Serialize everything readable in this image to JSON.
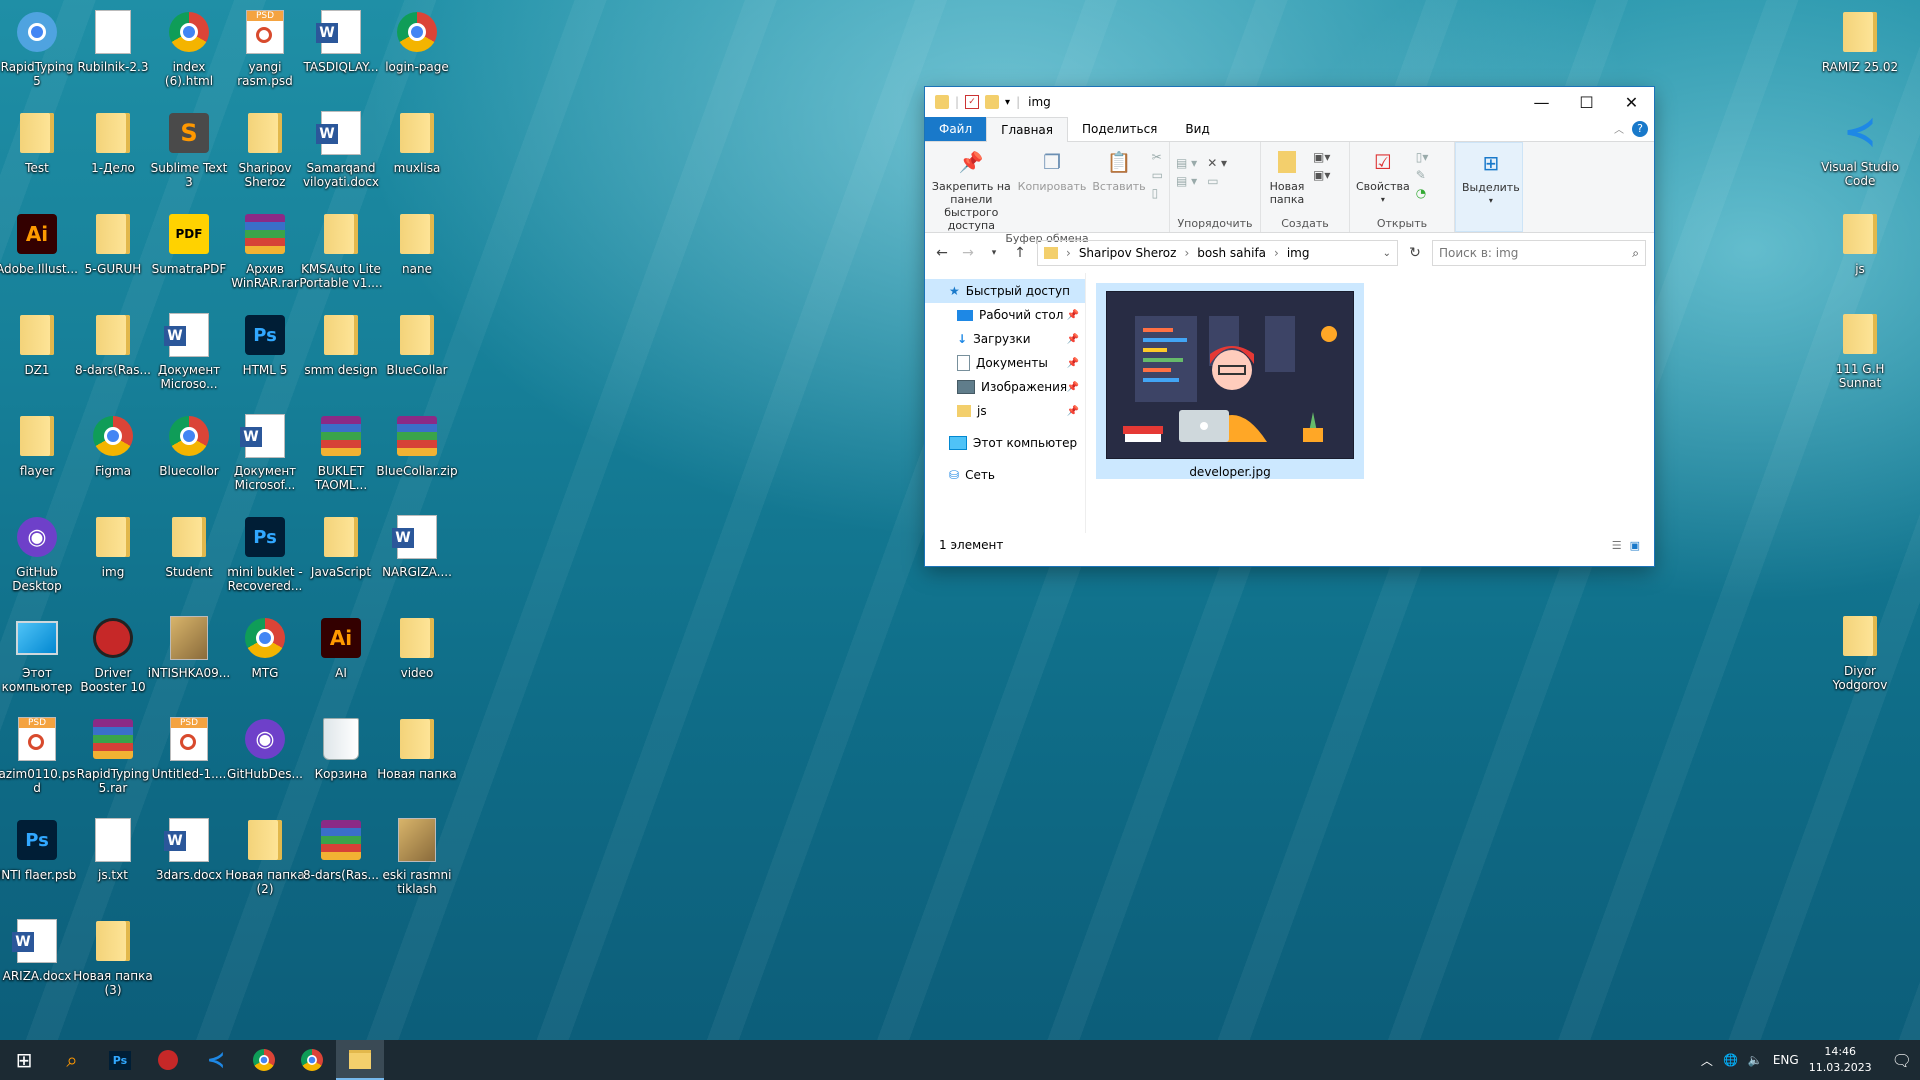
{
  "desktop": {
    "icons": [
      {
        "label": "RapidTyping 5",
        "icon": "rapidtyping-icon"
      },
      {
        "label": "Rubilnik-2.3",
        "icon": "document-icon"
      },
      {
        "label": "index (6).html",
        "icon": "chrome-icon"
      },
      {
        "label": "yangi rasm.psd",
        "icon": "psd-icon"
      },
      {
        "label": "TASDIQLAY...",
        "icon": "word-icon"
      },
      {
        "label": "login-page",
        "icon": "chrome-icon"
      },
      {
        "label": "Test",
        "icon": "folder-icon"
      },
      {
        "label": "1-Дело",
        "icon": "folder-icon"
      },
      {
        "label": "Sublime Text 3",
        "icon": "sublime-icon"
      },
      {
        "label": "Sharipov Sheroz",
        "icon": "folder-icon"
      },
      {
        "label": "Samarqand viloyati.docx",
        "icon": "word-icon"
      },
      {
        "label": "muxlisa",
        "icon": "folder-icon"
      },
      {
        "label": "Adobe.Illust...",
        "icon": "illustrator-icon"
      },
      {
        "label": "5-GURUH",
        "icon": "folder-icon"
      },
      {
        "label": "SumatraPDF",
        "icon": "pdf-icon"
      },
      {
        "label": "Архив WinRAR.rar",
        "icon": "winrar-icon"
      },
      {
        "label": "KMSAuto Lite Portable v1....",
        "icon": "folder-icon"
      },
      {
        "label": "nane",
        "icon": "folder-icon"
      },
      {
        "label": "DZ1",
        "icon": "folder-icon"
      },
      {
        "label": "8-dars(Ras...",
        "icon": "folder-icon"
      },
      {
        "label": "Документ Microso...",
        "icon": "word-icon"
      },
      {
        "label": "HTML 5",
        "icon": "photoshop-icon"
      },
      {
        "label": "smm design",
        "icon": "folder-icon"
      },
      {
        "label": "BlueCollar",
        "icon": "folder-icon"
      },
      {
        "label": "flayer",
        "icon": "folder-icon"
      },
      {
        "label": "Figma",
        "icon": "chrome-icon"
      },
      {
        "label": "Bluecollor",
        "icon": "chrome-icon"
      },
      {
        "label": "Документ Microsof...",
        "icon": "word-icon"
      },
      {
        "label": "BUKLET TAOML...",
        "icon": "winrar-icon"
      },
      {
        "label": "BlueCollar.zip",
        "icon": "winrar-icon"
      },
      {
        "label": "GitHub Desktop",
        "icon": "github-icon"
      },
      {
        "label": "img",
        "icon": "folder-icon"
      },
      {
        "label": "Student",
        "icon": "folder-icon"
      },
      {
        "label": "mini buklet -Recovered...",
        "icon": "photoshop-icon"
      },
      {
        "label": "JavaScript",
        "icon": "folder-icon"
      },
      {
        "label": "NARGIZA....",
        "icon": "word-icon"
      },
      {
        "label": "Этот компьютер",
        "icon": "computer-icon"
      },
      {
        "label": "Driver Booster 10",
        "icon": "driver-booster-icon"
      },
      {
        "label": "iNTISHKA09...",
        "icon": "image-file-icon"
      },
      {
        "label": "MTG",
        "icon": "chrome-icon"
      },
      {
        "label": "AI",
        "icon": "illustrator-icon"
      },
      {
        "label": "video",
        "icon": "folder-icon"
      },
      {
        "label": "azim0110.psd",
        "icon": "psd-icon"
      },
      {
        "label": "RapidTyping 5.rar",
        "icon": "winrar-icon"
      },
      {
        "label": "Untitled-1....",
        "icon": "psd-icon"
      },
      {
        "label": "GitHubDes...",
        "icon": "github-icon"
      },
      {
        "label": "Корзина",
        "icon": "recycle-bin-icon"
      },
      {
        "label": "Новая папка",
        "icon": "folder-icon"
      },
      {
        "label": "INTI flaer.psb",
        "icon": "photoshop-icon"
      },
      {
        "label": "js.txt",
        "icon": "text-file-icon"
      },
      {
        "label": "3dars.docx",
        "icon": "word-icon"
      },
      {
        "label": "Новая папка (2)",
        "icon": "folder-icon"
      },
      {
        "label": "8-dars(Ras...",
        "icon": "winrar-icon"
      },
      {
        "label": "eski rasmni tiklash",
        "icon": "image-file-icon"
      },
      {
        "label": "ARIZA.docx",
        "icon": "word-icon"
      },
      {
        "label": "Новая папка (3)",
        "icon": "folder-icon"
      }
    ],
    "right_icons": [
      {
        "label": "RAMIZ 25.02",
        "icon": "folder-icon"
      },
      {
        "label": "Visual Studio Code",
        "icon": "vscode-icon"
      },
      {
        "label": "js",
        "icon": "folder-icon"
      },
      {
        "label": "111 G.H Sunnat",
        "icon": "folder-icon"
      },
      {
        "label": "Diyor Yodgorov",
        "icon": "folder-icon"
      }
    ]
  },
  "explorer": {
    "title": "img",
    "tabs": [
      "Файл",
      "Главная",
      "Поделиться",
      "Вид"
    ],
    "ribbon": {
      "pin_label": "Закрепить на панели быстрого доступа",
      "copy_label": "Копировать",
      "paste_label": "Вставить",
      "clipboard_group": "Буфер обмена",
      "organize_group": "Упорядочить",
      "new_folder_label": "Новая папка",
      "create_group": "Создать",
      "properties_label": "Свойства",
      "open_group": "Открыть",
      "select_label": "Выделить"
    },
    "path": [
      "Sharipov Sheroz",
      "bosh sahifa",
      "img"
    ],
    "search_placeholder": "Поиск в: img",
    "nav": {
      "quick_access": "Быстрый доступ",
      "items": [
        {
          "label": "Рабочий стол",
          "icon": "desktop-icon"
        },
        {
          "label": "Загрузки",
          "icon": "downloads-icon"
        },
        {
          "label": "Документы",
          "icon": "documents-icon"
        },
        {
          "label": "Изображения",
          "icon": "pictures-icon"
        },
        {
          "label": "js",
          "icon": "folder-icon"
        }
      ],
      "this_pc": "Этот компьютер",
      "network": "Сеть"
    },
    "file": {
      "name": "developer.jpg"
    },
    "status": "1 элемент"
  },
  "taskbar": {
    "language": "ENG",
    "time": "14:46",
    "date": "11.03.2023"
  },
  "colors": {
    "accent": "#1979ca",
    "selection": "#cce8ff",
    "taskbar": "#1c2a33"
  }
}
